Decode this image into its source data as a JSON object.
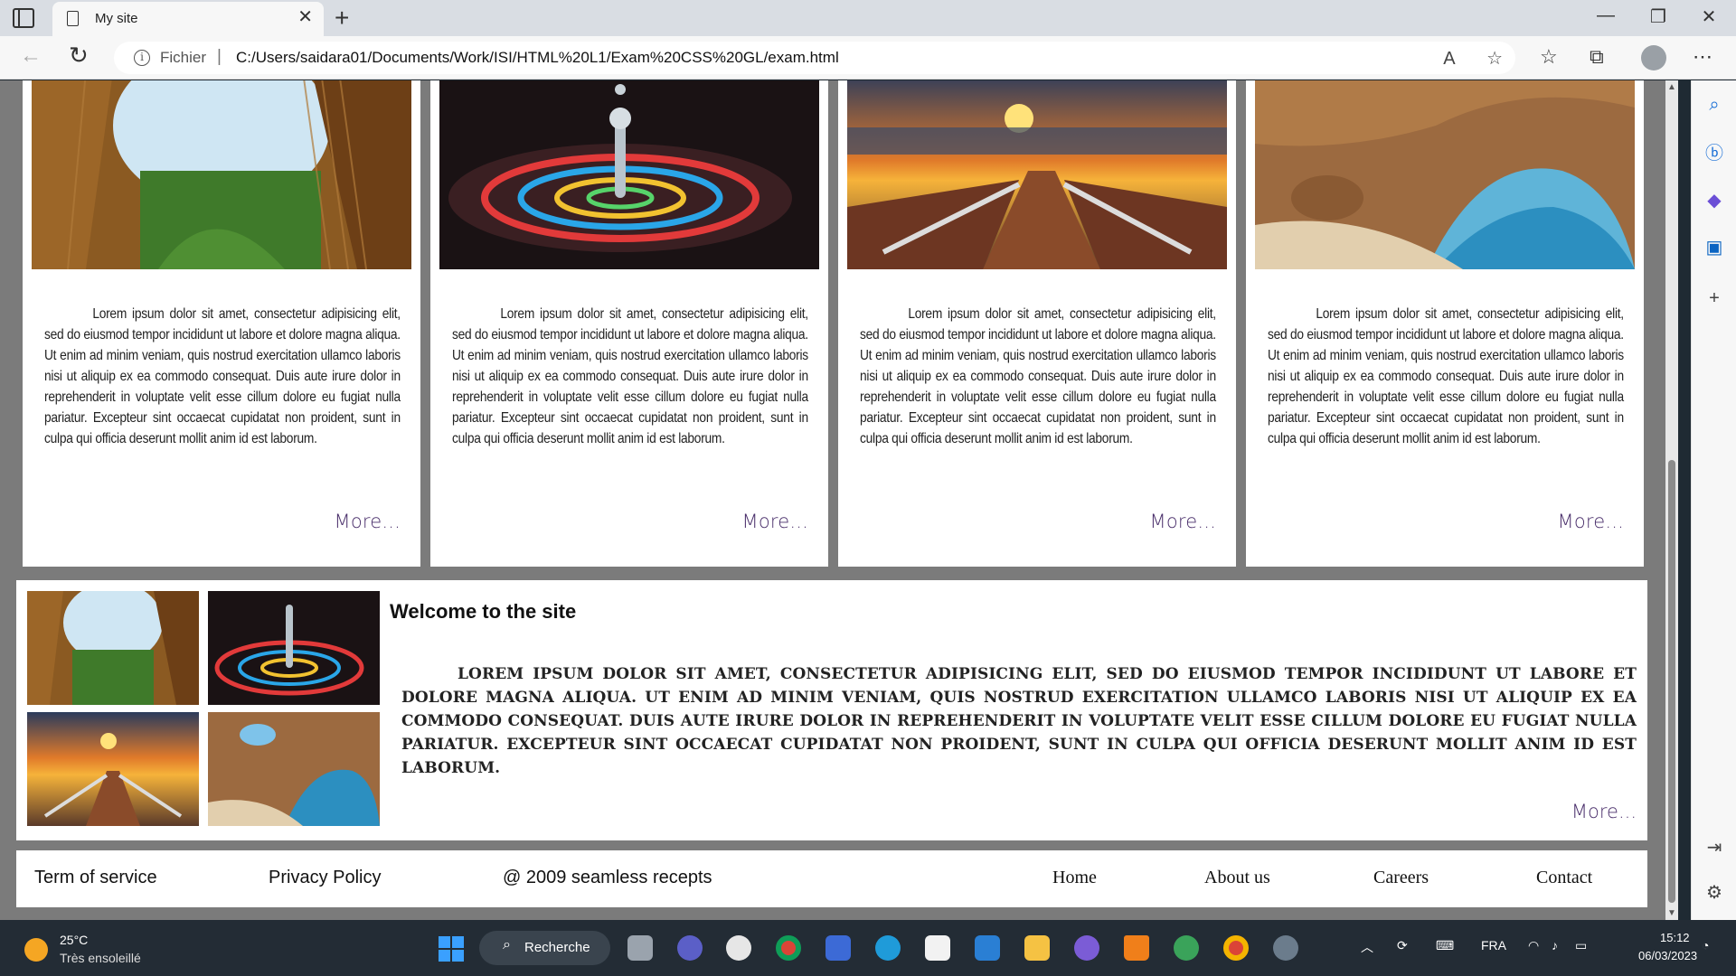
{
  "browser": {
    "tab_title": "My site",
    "address_label": "Fichier",
    "address_sep": "|",
    "url": "C:/Users/saidara01/Documents/Work/ISI/HTML%20L1/Exam%20CSS%20GL/exam.html",
    "new_tab_glyph": "+",
    "close_glyph": "✕"
  },
  "cards": [
    {
      "image": "cave-forest-photo",
      "text": "Lorem ipsum dolor sit amet, consectetur adipisicing elit, sed do eiusmod tempor incididunt ut labore et dolore magna aliqua. Ut enim ad minim veniam, quis nostrud exercitation ullamco laboris nisi ut aliquip ex ea commodo consequat. Duis aute irure dolor in reprehenderit in voluptate velit esse cillum dolore eu fugiat nulla pariatur. Excepteur sint occaecat cupidatat non proident, sunt in culpa qui officia deserunt mollit anim id est laborum.",
      "more": "More..."
    },
    {
      "image": "water-drop-photo",
      "text": "Lorem ipsum dolor sit amet, consectetur adipisicing elit, sed do eiusmod tempor incididunt ut labore et dolore magna aliqua. Ut enim ad minim veniam, quis nostrud exercitation ullamco laboris nisi ut aliquip ex ea commodo consequat. Duis aute irure dolor in reprehenderit in voluptate velit esse cillum dolore eu fugiat nulla pariatur. Excepteur sint occaecat cupidatat non proident, sunt in culpa qui officia deserunt mollit anim id est laborum.",
      "more": "More..."
    },
    {
      "image": "sunset-boardwalk-photo",
      "text": "Lorem ipsum dolor sit amet, consectetur adipisicing elit, sed do eiusmod tempor incididunt ut labore et dolore magna aliqua. Ut enim ad minim veniam, quis nostrud exercitation ullamco laboris nisi ut aliquip ex ea commodo consequat. Duis aute irure dolor in reprehenderit in voluptate velit esse cillum dolore eu fugiat nulla pariatur. Excepteur sint occaecat cupidatat non proident, sunt in culpa qui officia deserunt mollit anim id est laborum.",
      "more": "More..."
    },
    {
      "image": "sea-cave-photo",
      "text": "Lorem ipsum dolor sit amet, consectetur adipisicing elit, sed do eiusmod tempor incididunt ut labore et dolore magna aliqua. Ut enim ad minim veniam, quis nostrud exercitation ullamco laboris nisi ut aliquip ex ea commodo consequat. Duis aute irure dolor in reprehenderit in voluptate velit esse cillum dolore eu fugiat nulla pariatur. Excepteur sint occaecat cupidatat non proident, sunt in culpa qui officia deserunt mollit anim id est laborum.",
      "more": "More..."
    }
  ],
  "welcome": {
    "title": "Welcome to the site",
    "text": "Lorem ipsum dolor sit amet, consectetur adipisicing elit, sed do eiusmod tempor incididunt ut labore et dolore magna aliqua. Ut enim ad minim veniam, quis nostrud exercitation ullamco laboris nisi ut aliquip ex ea commodo consequat. Duis aute irure dolor in reprehenderit in voluptate velit esse cillum dolore eu fugiat nulla pariatur. Excepteur sint occaecat cupidatat non proident, sunt in culpa qui officia deserunt mollit anim id est laborum.",
    "more": "More..."
  },
  "footer": {
    "left": [
      "Term of service",
      "Privacy Policy",
      "@ 2009 seamless recepts"
    ],
    "right": [
      "Home",
      "About us",
      "Careers",
      "Contact"
    ]
  },
  "taskbar": {
    "temperature": "25°C",
    "weather": "Très ensoleillé",
    "search": "Recherche",
    "language": "FRA",
    "time": "15:12",
    "date": "06/03/2023"
  },
  "colors": {
    "page_background": "#7b7b7b",
    "link_color": "#4a2f6b",
    "taskbar": "#232c35"
  }
}
